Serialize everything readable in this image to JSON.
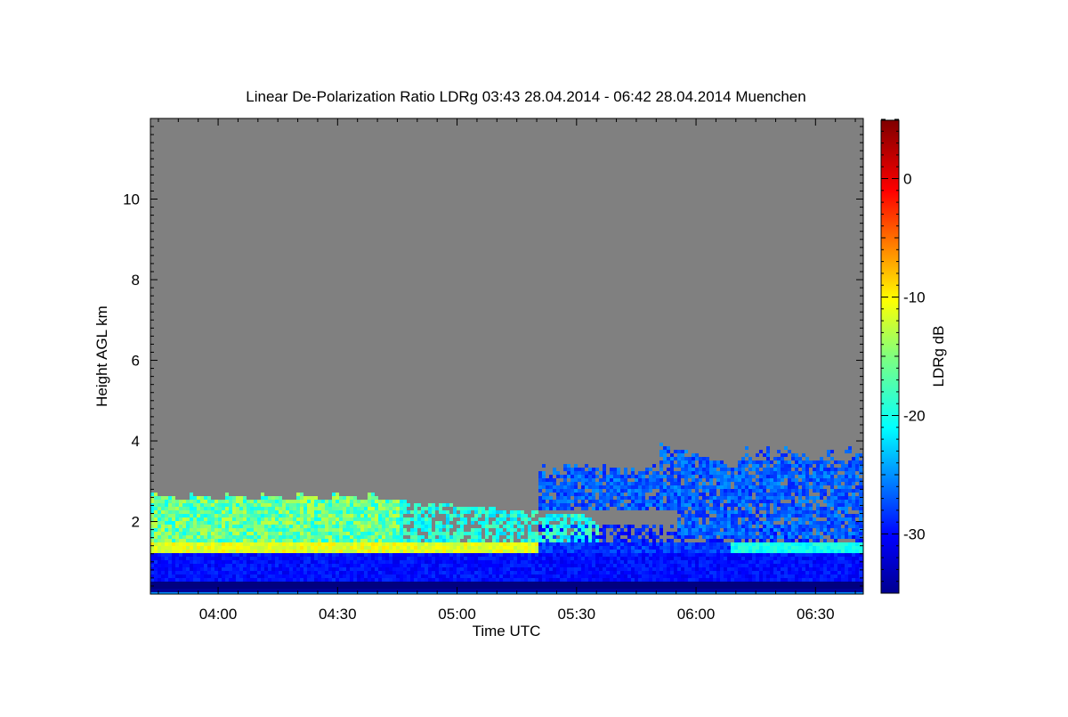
{
  "chart_data": {
    "type": "heatmap",
    "title": "Linear De-Polarization Ratio LDRg   03:43 28.04.2014 - 06:42 28.04.2014 Muenchen",
    "xlabel": "Time UTC",
    "ylabel": "Height AGL km",
    "colorbar_label": "LDRg dB",
    "xlim": [
      "03:43",
      "06:42"
    ],
    "ylim": [
      0.2,
      12.0
    ],
    "x_ticks": [
      "04:00",
      "04:30",
      "05:00",
      "05:30",
      "06:00",
      "06:30"
    ],
    "y_ticks": [
      2,
      4,
      6,
      8,
      10
    ],
    "colorbar_range": [
      -35,
      5
    ],
    "colorbar_ticks": [
      0,
      -10,
      -20,
      -30
    ],
    "colormap": "jet",
    "background_color": "#808080",
    "layers": [
      {
        "feature": "surface layer (very low LDRg)",
        "height_km": [
          0.2,
          0.55
        ],
        "ldr_db": -35
      },
      {
        "feature": "boundary layer aerosol",
        "height_km": [
          0.55,
          1.3
        ],
        "ldr_db": -30
      },
      {
        "feature": "bright depolarizing band",
        "height_km": [
          1.3,
          1.5
        ],
        "ldr_db": -12,
        "time": [
          "03:43",
          "05:20"
        ]
      },
      {
        "feature": "fall streaks / virga (high depol)",
        "height_km": [
          1.5,
          2.8
        ],
        "ldr_db": -20,
        "time": [
          "03:43",
          "05:30"
        ]
      },
      {
        "feature": "mid-level cloud, low depol",
        "height_km": [
          1.6,
          4.1
        ],
        "ldr_db": -28,
        "time": [
          "05:30",
          "06:42"
        ]
      }
    ]
  }
}
